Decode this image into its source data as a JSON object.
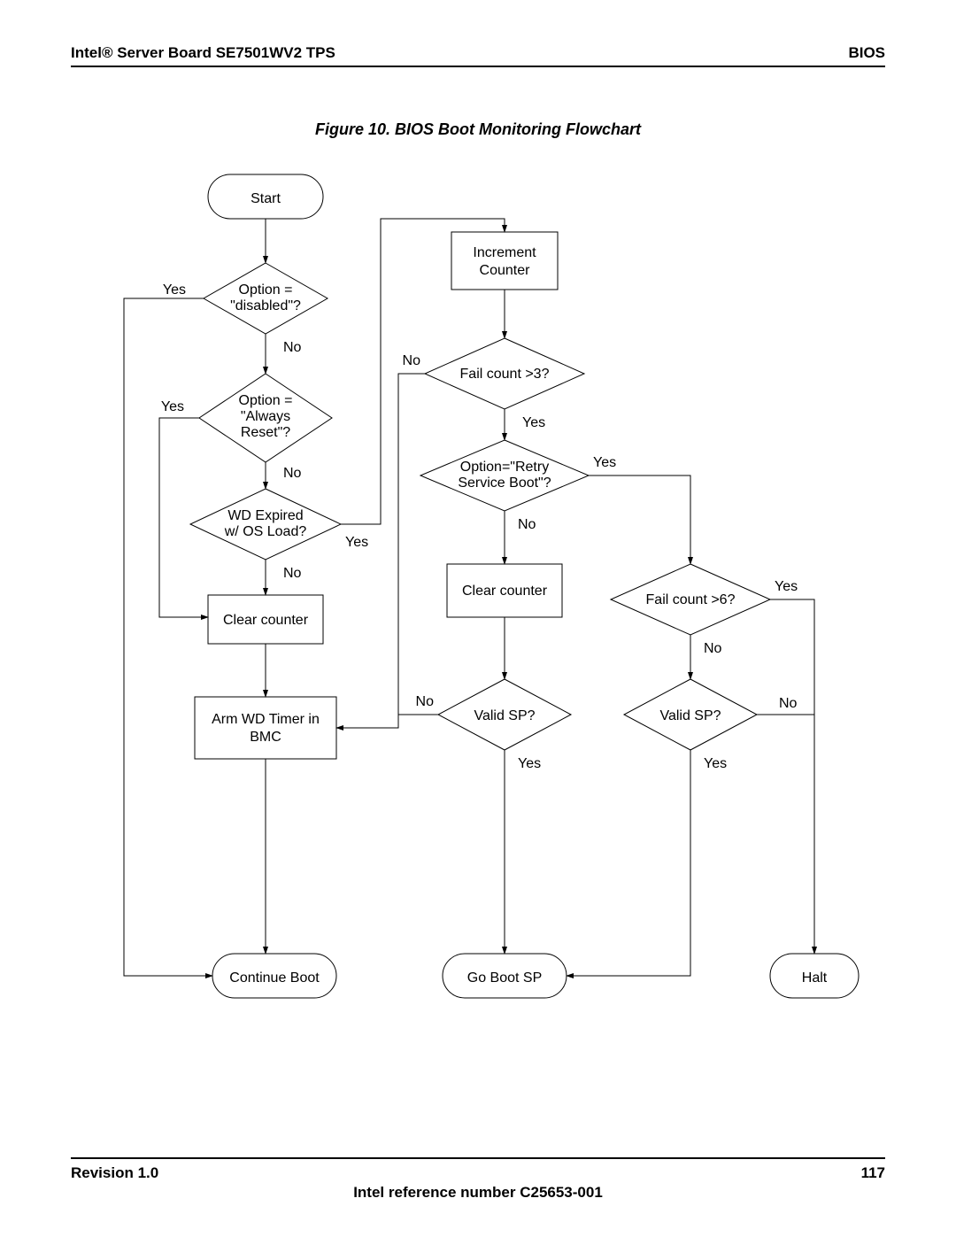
{
  "header": {
    "left": "Intel® Server Board SE7501WV2 TPS",
    "right": "BIOS"
  },
  "figure_title": "Figure 10. BIOS Boot Monitoring Flowchart",
  "nodes": {
    "start": "Start",
    "option_disabled": "Option = \"disabled\"?",
    "option_always_reset_l1": "Option =",
    "option_always_reset_l2": "\"Always",
    "option_always_reset_l3": "Reset\"?",
    "wd_expired_l1": "WD Expired",
    "wd_expired_l2": "w/ OS Load?",
    "clear_counter_left": "Clear counter",
    "arm_wd_l1": "Arm WD Timer in",
    "arm_wd_l2": "BMC",
    "continue_boot": "Continue Boot",
    "increment_l1": "Increment",
    "increment_l2": "Counter",
    "fail3": "Fail count >3?",
    "retry_l1": "Option=\"Retry",
    "retry_l2": "Service Boot\"?",
    "clear_counter_mid": "Clear counter",
    "valid_sp_mid": "Valid SP?",
    "go_boot_sp": "Go Boot SP",
    "fail6": "Fail count >6?",
    "valid_sp_right": "Valid SP?",
    "halt": "Halt"
  },
  "labels": {
    "yes": "Yes",
    "no": "No"
  },
  "footer": {
    "left": "Revision 1.0",
    "right": "117",
    "center": "Intel reference number C25653-001"
  }
}
